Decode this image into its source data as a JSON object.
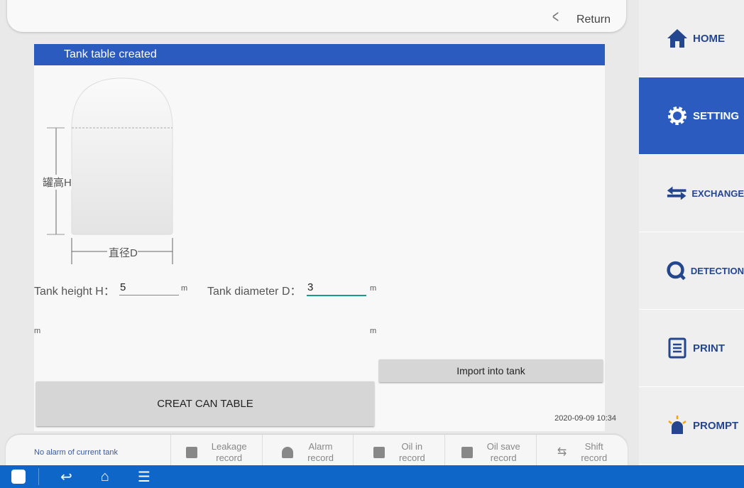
{
  "header": {
    "return_label": "Return"
  },
  "panel": {
    "title": "Tank table created",
    "diagram": {
      "height_label": "罐高H",
      "diameter_label": "直径D"
    },
    "height_label": "Tank height H：",
    "height_value": "5",
    "height_unit": "m",
    "diameter_label": "Tank diameter D：",
    "diameter_value": "3",
    "diameter_unit": "m",
    "unit_left": "m",
    "unit_right": "m",
    "import_button": "Import into tank",
    "create_button": "CREAT CAN TABLE",
    "datetime": "2020-09-09 10:34"
  },
  "sidebar": {
    "items": [
      {
        "label": "HOME",
        "icon": "home-icon"
      },
      {
        "label": "SETTING",
        "icon": "gear-icon",
        "active": true
      },
      {
        "label": "EXCHANGE",
        "icon": "exchange-icon"
      },
      {
        "label": "DETECTION",
        "icon": "detection-icon"
      },
      {
        "label": "PRINT",
        "icon": "print-icon"
      },
      {
        "label": "PROMPT",
        "icon": "alarm-light-icon"
      }
    ]
  },
  "bottom": {
    "status": "No alarm of current tank",
    "records": [
      {
        "l1": "Leakage",
        "l2": "record"
      },
      {
        "l1": "Alarm",
        "l2": "record"
      },
      {
        "l1": "Oil in",
        "l2": "record"
      },
      {
        "l1": "Oil save",
        "l2": "record"
      },
      {
        "l1": "Shift",
        "l2": "record"
      }
    ]
  },
  "colors": {
    "accent": "#2c5bbf",
    "navbar": "#0e66c8",
    "input_focus": "#1a9a8a"
  }
}
